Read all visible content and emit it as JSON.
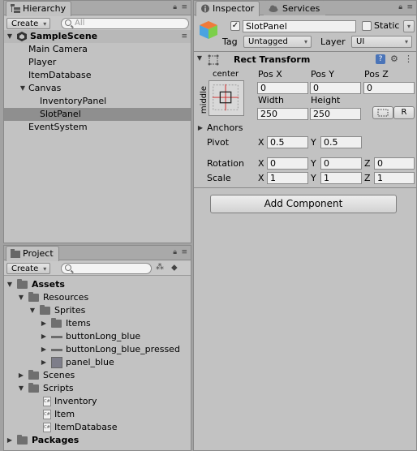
{
  "hierarchy": {
    "tab_label": "Hierarchy",
    "create_label": "Create",
    "search_placeholder": "All",
    "scene_name": "SampleScene",
    "items": [
      {
        "label": "Main Camera"
      },
      {
        "label": "Player"
      },
      {
        "label": "ItemDatabase"
      },
      {
        "label": "Canvas"
      },
      {
        "label": "InventoryPanel"
      },
      {
        "label": "SlotPanel"
      },
      {
        "label": "EventSystem"
      }
    ]
  },
  "project": {
    "tab_label": "Project",
    "create_label": "Create",
    "tree": [
      {
        "label": "Assets"
      },
      {
        "label": "Resources"
      },
      {
        "label": "Sprites"
      },
      {
        "label": "Items"
      },
      {
        "label": "buttonLong_blue"
      },
      {
        "label": "buttonLong_blue_pressed"
      },
      {
        "label": "panel_blue"
      },
      {
        "label": "Scenes"
      },
      {
        "label": "Scripts"
      },
      {
        "label": "Inventory"
      },
      {
        "label": "Item"
      },
      {
        "label": "ItemDatabase"
      },
      {
        "label": "Packages"
      }
    ],
    "script_badge": "C#"
  },
  "inspector": {
    "tab_label": "Inspector",
    "services_tab_label": "Services",
    "object_name": "SlotPanel",
    "active_checked": "✓",
    "static_label": "Static",
    "tag_label": "Tag",
    "tag_value": "Untagged",
    "layer_label": "Layer",
    "layer_value": "UI",
    "component_title": "Rect Transform",
    "anchor_h": "center",
    "anchor_v": "middle",
    "pos_x_label": "Pos X",
    "pos_y_label": "Pos Y",
    "pos_z_label": "Pos Z",
    "pos_x": "0",
    "pos_y": "0",
    "pos_z": "0",
    "width_label": "Width",
    "height_label": "Height",
    "width": "250",
    "height": "250",
    "r_button_label": "R",
    "anchors_label": "Anchors",
    "pivot_label": "Pivot",
    "pivot_x": "0.5",
    "pivot_y": "0.5",
    "rotation_label": "Rotation",
    "rotation_x": "0",
    "rotation_y": "0",
    "rotation_z": "0",
    "scale_label": "Scale",
    "scale_x": "1",
    "scale_y": "1",
    "scale_z": "1",
    "axis_x": "X",
    "axis_y": "Y",
    "axis_z": "Z",
    "add_component_label": "Add Component"
  },
  "icons": [
    "hierarchy-icon",
    "project-icon",
    "inspector-icon",
    "lock-icon",
    "menu-icon",
    "unity-scene-icon",
    "folder-icon",
    "script-icon",
    "cube-icon",
    "help-icon",
    "settings-icon",
    "anchor-preset-icon"
  ]
}
